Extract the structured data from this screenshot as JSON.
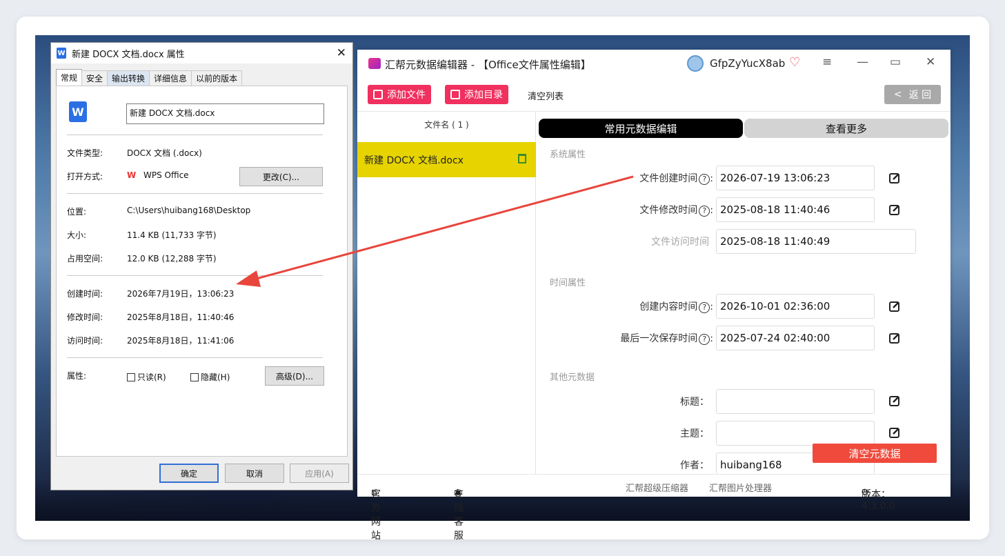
{
  "dialog": {
    "title": "新建 DOCX 文档.docx 属性",
    "tabs": [
      "常规",
      "安全",
      "输出转换",
      "详细信息",
      "以前的版本"
    ],
    "file_name": "新建 DOCX 文档.docx",
    "file_type_label": "文件类型:",
    "file_type_value": "DOCX 文档 (.docx)",
    "open_with_label": "打开方式:",
    "open_with_value": "WPS Office",
    "change_button": "更改(C)...",
    "location_label": "位置:",
    "location_value": "C:\\Users\\huibang168\\Desktop",
    "size_label": "大小:",
    "size_value": "11.4 KB (11,733 字节)",
    "disk_label": "占用空间:",
    "disk_value": "12.0 KB (12,288 字节)",
    "created_label": "创建时间:",
    "created_value": "2026年7月19日，13:06:23",
    "modified_label": "修改时间:",
    "modified_value": "2025年8月18日，11:40:46",
    "accessed_label": "访问时间:",
    "accessed_value": "2025年8月18日，11:41:06",
    "attr_label": "属性:",
    "readonly_label": "只读(R)",
    "hidden_label": "隐藏(H)",
    "advanced_button": "高级(D)...",
    "ok_button": "确定",
    "cancel_button": "取消",
    "apply_button": "应用(A)"
  },
  "app": {
    "title": "汇帮元数据编辑器 - 【Office文件属性编辑】",
    "user": "GfpZyYucX8ab",
    "add_file": "添加文件",
    "add_dir": "添加目录",
    "clear_list": "清空列表",
    "back": "返 回",
    "file_list_header": "文件名 ( 1 )",
    "files": [
      "新建 DOCX 文档.docx"
    ],
    "tab_common": "常用元数据编辑",
    "tab_more": "查看更多",
    "section_system": "系统属性",
    "section_time": "时间属性",
    "section_other": "其他元数据",
    "fields": {
      "create_label": "文件创建时间",
      "create_value": "2026-07-19 13:06:23",
      "modify_label": "文件修改时间",
      "modify_value": "2025-08-18 11:40:46",
      "access_label": "文件访问时间",
      "access_value": "2025-08-18 11:40:49",
      "content_create_label": "创建内容时间",
      "content_create_value": "2026-10-01 02:36:00",
      "last_save_label": "最后一次保存时间",
      "last_save_value": "2025-07-24 02:40:00",
      "title_label": "标题：",
      "title_value": "",
      "subject_label": "主题：",
      "subject_value": "",
      "author_label": "作者：",
      "author_value": "huibang168"
    },
    "clear_meta": "清空元数据",
    "footer": {
      "website": "官方网站",
      "support": "在线客服",
      "compressor": "汇帮超级压缩器",
      "image_tool": "汇帮图片处理器",
      "version": "版本：4.3.0.0"
    }
  },
  "colors": {
    "accent_pink": "#f0305e",
    "selected_file": "#e6d300",
    "clear_button": "#f04a3c",
    "arrow": "#e8453c"
  }
}
